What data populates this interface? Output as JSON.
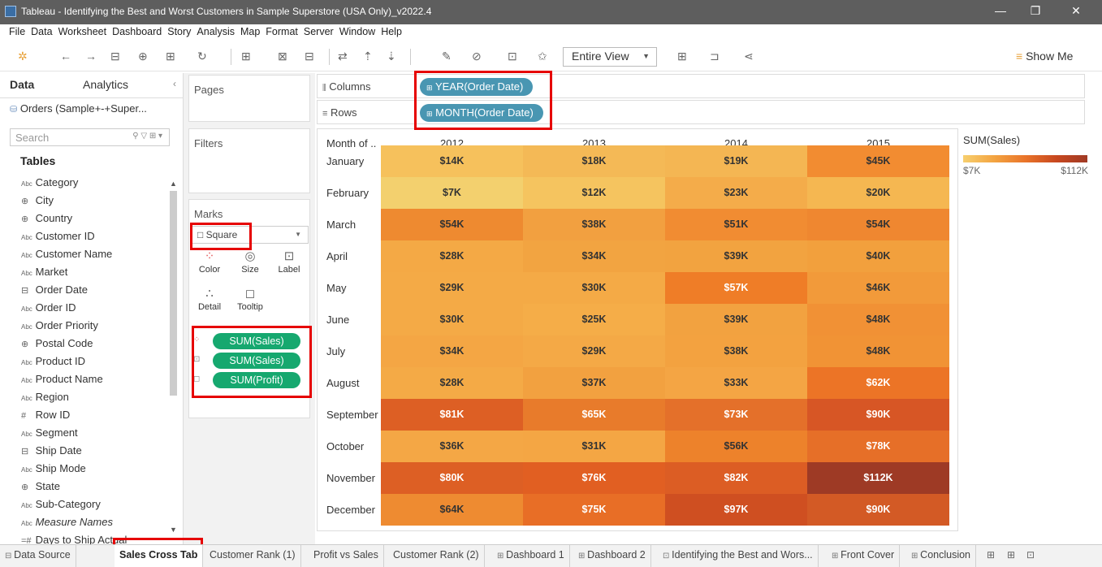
{
  "window": {
    "title": "Tableau - Identifying the Best and Worst Customers in Sample Superstore (USA Only)_v2022.4"
  },
  "menu": [
    "File",
    "Data",
    "Worksheet",
    "Dashboard",
    "Story",
    "Analysis",
    "Map",
    "Format",
    "Server",
    "Window",
    "Help"
  ],
  "toolbar": {
    "view_select": "Entire View",
    "show_me": "Show Me"
  },
  "data_pane": {
    "tabs": {
      "data": "Data",
      "analytics": "Analytics"
    },
    "datasource": "Orders (Sample+-+Super...",
    "search_placeholder": "Search",
    "tables_header": "Tables",
    "fields": [
      {
        "name": "Category",
        "type": "Abc"
      },
      {
        "name": "City",
        "type": "geo"
      },
      {
        "name": "Country",
        "type": "geo"
      },
      {
        "name": "Customer ID",
        "type": "Abc"
      },
      {
        "name": "Customer Name",
        "type": "Abc"
      },
      {
        "name": "Market",
        "type": "Abc"
      },
      {
        "name": "Order Date",
        "type": "date"
      },
      {
        "name": "Order ID",
        "type": "Abc"
      },
      {
        "name": "Order Priority",
        "type": "Abc"
      },
      {
        "name": "Postal Code",
        "type": "geo"
      },
      {
        "name": "Product ID",
        "type": "Abc"
      },
      {
        "name": "Product Name",
        "type": "Abc"
      },
      {
        "name": "Region",
        "type": "Abc"
      },
      {
        "name": "Row ID",
        "type": "#"
      },
      {
        "name": "Segment",
        "type": "Abc"
      },
      {
        "name": "Ship Date",
        "type": "date"
      },
      {
        "name": "Ship Mode",
        "type": "Abc"
      },
      {
        "name": "State",
        "type": "geo"
      },
      {
        "name": "Sub-Category",
        "type": "Abc"
      },
      {
        "name": "Measure Names",
        "type": "Abc",
        "italic": true
      },
      {
        "name": "Days to Ship Actual",
        "type": "calc"
      }
    ]
  },
  "cards": {
    "pages": "Pages",
    "filters": "Filters",
    "marks": "Marks",
    "mark_type": "Square",
    "mark_buttons": [
      "Color",
      "Size",
      "Label",
      "Detail",
      "Tooltip"
    ],
    "mark_pills": [
      "SUM(Sales)",
      "SUM(Sales)",
      "SUM(Profit)"
    ]
  },
  "shelves": {
    "columns_label": "Columns",
    "rows_label": "Rows",
    "columns_pill": "YEAR(Order Date)",
    "rows_pill": "MONTH(Order Date)"
  },
  "crosstab": {
    "row_header": "Month of ..",
    "years": [
      "2012",
      "2013",
      "2014",
      "2015"
    ],
    "months": [
      "January",
      "February",
      "March",
      "April",
      "May",
      "June",
      "July",
      "August",
      "September",
      "October",
      "November",
      "December"
    ],
    "labels": [
      [
        "$14K",
        "$18K",
        "$19K",
        "$45K"
      ],
      [
        "$7K",
        "$12K",
        "$23K",
        "$20K"
      ],
      [
        "$54K",
        "$38K",
        "$51K",
        "$54K"
      ],
      [
        "$28K",
        "$34K",
        "$39K",
        "$40K"
      ],
      [
        "$29K",
        "$30K",
        "$57K",
        "$46K"
      ],
      [
        "$30K",
        "$25K",
        "$39K",
        "$48K"
      ],
      [
        "$34K",
        "$29K",
        "$38K",
        "$48K"
      ],
      [
        "$28K",
        "$37K",
        "$33K",
        "$62K"
      ],
      [
        "$81K",
        "$65K",
        "$73K",
        "$90K"
      ],
      [
        "$36K",
        "$31K",
        "$56K",
        "$78K"
      ],
      [
        "$80K",
        "$76K",
        "$82K",
        "$112K"
      ],
      [
        "$64K",
        "$75K",
        "$97K",
        "$90K"
      ]
    ],
    "colors": [
      [
        "#f6c15c",
        "#f4b956",
        "#f4b653",
        "#f28c31"
      ],
      [
        "#f3d06e",
        "#f5c45f",
        "#f4ac4a",
        "#f5b751"
      ],
      [
        "#ee8a30",
        "#f2a040",
        "#f18c32",
        "#ef8730"
      ],
      [
        "#f4a945",
        "#f2a441",
        "#f2a340",
        "#f2a03d"
      ],
      [
        "#f4aa46",
        "#f4aa46",
        "#ef7d27",
        "#f29a3a"
      ],
      [
        "#f4aa46",
        "#f5ad48",
        "#f2a240",
        "#f19135"
      ],
      [
        "#f4a644",
        "#f4a946",
        "#f3a240",
        "#f19335"
      ],
      [
        "#f4aa46",
        "#f2a140",
        "#f4a544",
        "#ec7426"
      ],
      [
        "#dd5f24",
        "#e87b2b",
        "#e4702a",
        "#d75625"
      ],
      [
        "#f4a745",
        "#f4a644",
        "#ed822b",
        "#e66f28"
      ],
      [
        "#dd5f24",
        "#e15f22",
        "#dc5d24",
        "#9e3a25"
      ],
      [
        "#ee8b31",
        "#e86e26",
        "#cf4f21",
        "#d35a25"
      ]
    ]
  },
  "legend": {
    "title": "SUM(Sales)",
    "min": "$7K",
    "max": "$112K"
  },
  "sheet_tabs": [
    {
      "label": "Data Source",
      "sym": "⊟",
      "active": false
    },
    {
      "label": "Sales Cross Tab",
      "sym": "",
      "active": true
    },
    {
      "label": "Customer Rank (1)",
      "sym": "",
      "active": false
    },
    {
      "label": "Profit vs Sales",
      "sym": "",
      "active": false
    },
    {
      "label": "Customer Rank (2)",
      "sym": "",
      "active": false
    },
    {
      "label": "Dashboard 1",
      "sym": "⊞",
      "active": false
    },
    {
      "label": "Dashboard 2",
      "sym": "⊞",
      "active": false
    },
    {
      "label": "Identifying the Best and Wors...",
      "sym": "⊡",
      "active": false
    },
    {
      "label": "Front Cover",
      "sym": "⊞",
      "active": false
    },
    {
      "label": "Conclusion",
      "sym": "⊞",
      "active": false
    }
  ]
}
